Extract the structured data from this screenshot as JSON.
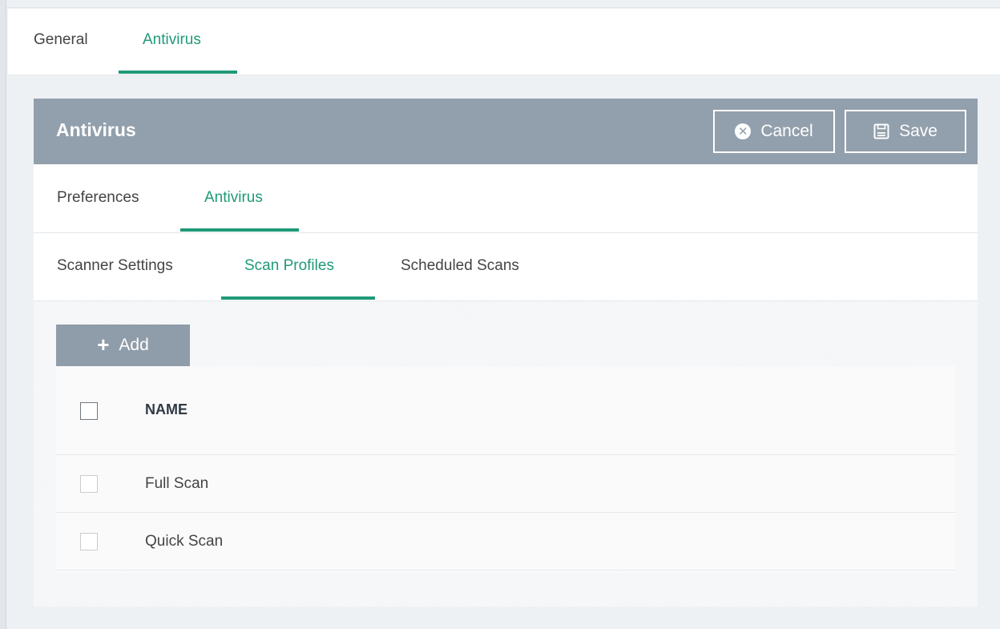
{
  "top_tabs": [
    {
      "label": "General",
      "active": false
    },
    {
      "label": "Antivirus",
      "active": true
    }
  ],
  "panel": {
    "title": "Antivirus",
    "cancel_label": "Cancel",
    "save_label": "Save"
  },
  "sub_tabs": [
    {
      "label": "Preferences",
      "active": false
    },
    {
      "label": "Antivirus",
      "active": true
    }
  ],
  "inner_tabs": [
    {
      "label": "Scanner Settings",
      "active": false
    },
    {
      "label": "Scan Profiles",
      "active": true
    },
    {
      "label": "Scheduled Scans",
      "active": false
    }
  ],
  "add_button": {
    "label": "Add"
  },
  "table": {
    "columns": [
      "NAME"
    ],
    "rows": [
      {
        "name": "Full Scan",
        "checked": false
      },
      {
        "name": "Quick Scan",
        "checked": false
      }
    ]
  },
  "colors": {
    "accent": "#1f9a79",
    "header_bg": "#929fac",
    "add_button_bg": "#8f9ca9"
  }
}
